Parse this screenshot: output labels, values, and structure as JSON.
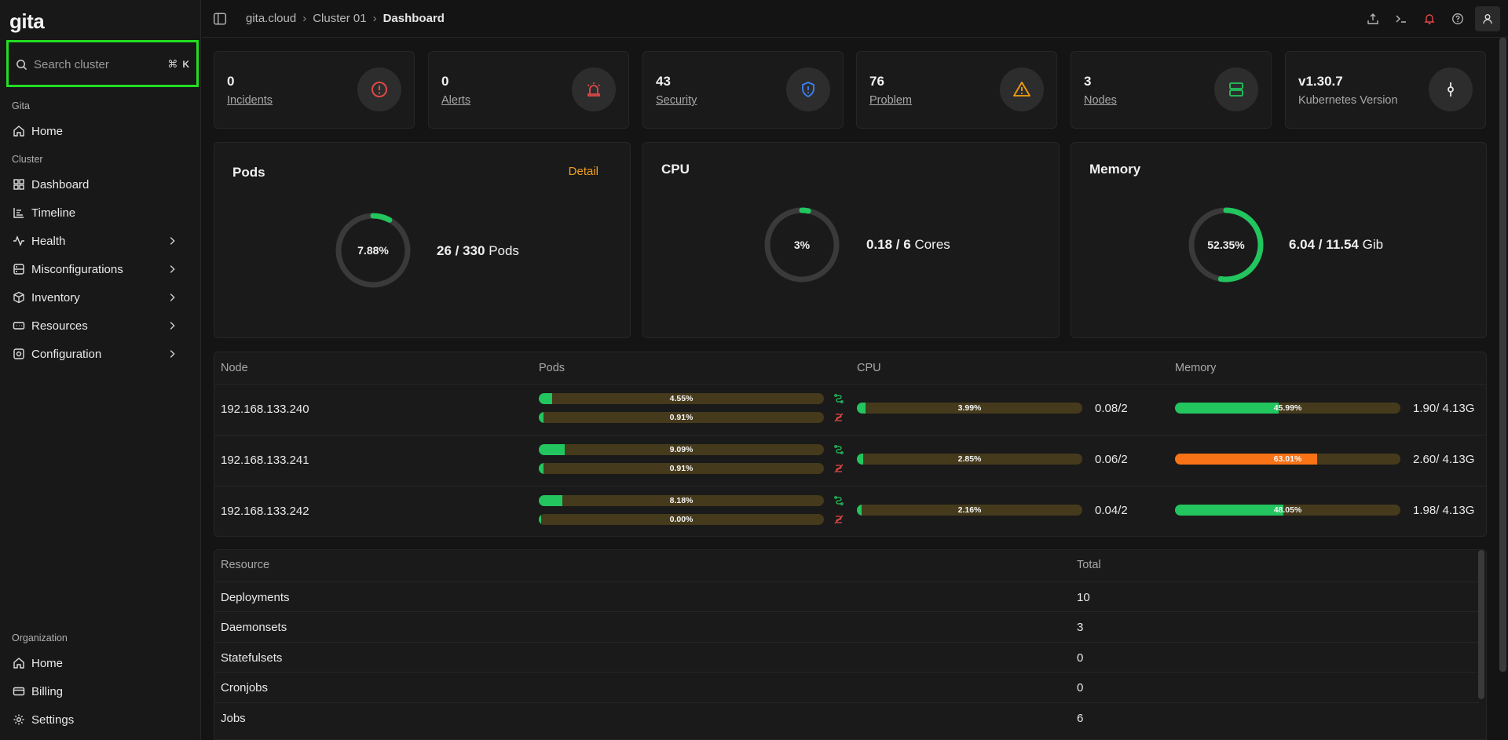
{
  "app": {
    "logo": "gita"
  },
  "search": {
    "placeholder": "Search cluster",
    "shortcut_mod": "⌘",
    "shortcut_key": "K"
  },
  "sidebar": {
    "group_gita": "Gita",
    "group_cluster": "Cluster",
    "group_org": "Organization",
    "items": [
      {
        "label": "Home",
        "icon": "home-icon"
      },
      {
        "label": "Dashboard",
        "icon": "grid-icon"
      },
      {
        "label": "Timeline",
        "icon": "chart-icon"
      },
      {
        "label": "Health",
        "icon": "pulse-icon"
      },
      {
        "label": "Misconfigurations",
        "icon": "misconfig-icon"
      },
      {
        "label": "Inventory",
        "icon": "box-icon"
      },
      {
        "label": "Resources",
        "icon": "resources-icon"
      },
      {
        "label": "Configuration",
        "icon": "config-icon"
      },
      {
        "label": "Home",
        "icon": "home-icon"
      },
      {
        "label": "Billing",
        "icon": "billing-icon"
      },
      {
        "label": "Settings",
        "icon": "gear-icon"
      }
    ]
  },
  "header": {
    "breadcrumb": [
      "gita.cloud",
      "Cluster 01",
      "Dashboard"
    ],
    "separator": "›"
  },
  "stats": [
    {
      "value": "0",
      "label": "Incidents",
      "icon": "alert-circle-icon",
      "color": "#e04848"
    },
    {
      "value": "0",
      "label": "Alerts",
      "icon": "siren-icon",
      "color": "#e04848"
    },
    {
      "value": "43",
      "label": "Security",
      "icon": "shield-icon",
      "color": "#3b82f6"
    },
    {
      "value": "76",
      "label": "Problem",
      "icon": "warning-icon",
      "color": "#f59e0b"
    },
    {
      "value": "3",
      "label": "Nodes",
      "icon": "server-icon",
      "color": "#22c55e"
    },
    {
      "value": "v1.30.7",
      "label": "Kubernetes Version",
      "icon": "commit-icon",
      "color": "#e6e6e6"
    }
  ],
  "pods": {
    "title": "Pods",
    "detail": "Detail",
    "percent_label": "7.88%",
    "percent": 7.88,
    "value": "26 / 330",
    "unit": "Pods"
  },
  "cpu": {
    "title": "CPU",
    "percent_label": "3%",
    "percent": 3,
    "value": "0.18 / 6",
    "unit": "Cores"
  },
  "memory": {
    "title": "Memory",
    "percent_label": "52.35%",
    "percent": 52.35,
    "value": "6.04 / 11.54",
    "unit": "Gib"
  },
  "nodes_table": {
    "headers": [
      "Node",
      "Pods",
      "CPU",
      "Memory"
    ],
    "rows": [
      {
        "ip": "192.168.133.240",
        "pods1": "4.55%",
        "pods1_pct": 4.55,
        "pods2": "0.91%",
        "pods2_pct": 0.91,
        "cpu": "3.99%",
        "cpu_pct": 3.99,
        "cpu_val": "0.08/2",
        "mem": "45.99%",
        "mem_pct": 45.99,
        "mem_val": "1.90/ 4.13G",
        "mem_color": "#22c55e"
      },
      {
        "ip": "192.168.133.241",
        "pods1": "9.09%",
        "pods1_pct": 9.09,
        "pods2": "0.91%",
        "pods2_pct": 0.91,
        "cpu": "2.85%",
        "cpu_pct": 2.85,
        "cpu_val": "0.06/2",
        "mem": "63.01%",
        "mem_pct": 63.01,
        "mem_val": "2.60/ 4.13G",
        "mem_color": "#f97316"
      },
      {
        "ip": "192.168.133.242",
        "pods1": "8.18%",
        "pods1_pct": 8.18,
        "pods2": "0.00%",
        "pods2_pct": 0,
        "cpu": "2.16%",
        "cpu_pct": 2.16,
        "cpu_val": "0.04/2",
        "mem": "48.05%",
        "mem_pct": 48.05,
        "mem_val": "1.98/ 4.13G",
        "mem_color": "#22c55e"
      }
    ]
  },
  "resources_table": {
    "headers": [
      "Resource",
      "Total"
    ],
    "rows": [
      {
        "name": "Deployments",
        "total": "10"
      },
      {
        "name": "Daemonsets",
        "total": "3"
      },
      {
        "name": "Statefulsets",
        "total": "0"
      },
      {
        "name": "Cronjobs",
        "total": "0"
      },
      {
        "name": "Jobs",
        "total": "6"
      }
    ]
  },
  "colors": {
    "accent": "#22c55e",
    "track": "#453a1b",
    "detail": "#f0a020",
    "search_highlight": "#22dd22"
  }
}
